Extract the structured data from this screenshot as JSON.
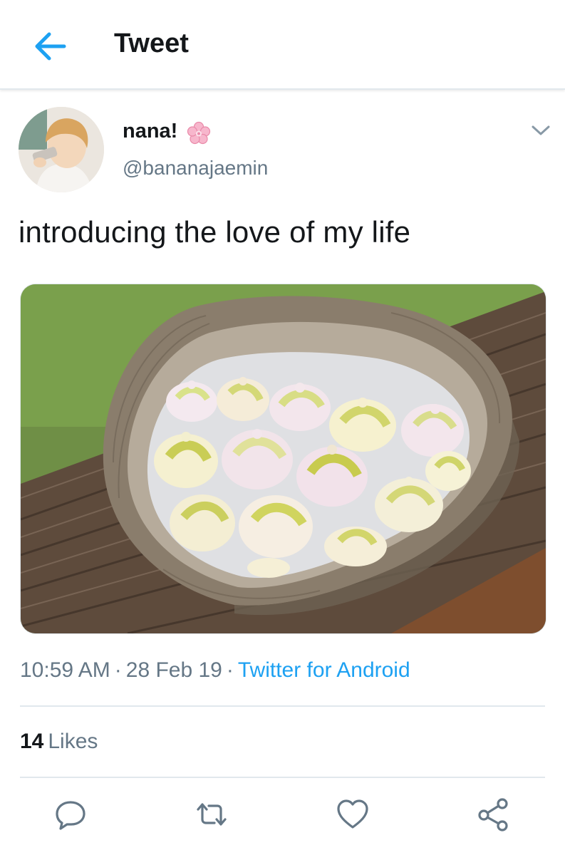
{
  "header": {
    "title": "Tweet",
    "back_icon": "arrow-left-icon",
    "accent": "#1da1f2"
  },
  "author": {
    "display_name": "nana!",
    "name_emoji_icon": "cherry-blossom-icon",
    "handle": "@bananajaemin",
    "avatar_icon": "user-avatar-photo"
  },
  "tweet": {
    "text": "introducing the love of my life",
    "media_alt_icon": "photo-meringues-in-heart-basket"
  },
  "meta": {
    "time": "10:59 AM",
    "date": "28 Feb 19",
    "separator": "·",
    "source": "Twitter for Android"
  },
  "stats": {
    "likes_count": "14",
    "likes_label": "Likes"
  },
  "actions": [
    {
      "icon": "reply-icon"
    },
    {
      "icon": "retweet-icon"
    },
    {
      "icon": "like-icon"
    },
    {
      "icon": "share-icon"
    }
  ],
  "colors": {
    "text": "#14171a",
    "secondary": "#657786",
    "link": "#1da1f2",
    "divider": "#e1e8ed"
  }
}
